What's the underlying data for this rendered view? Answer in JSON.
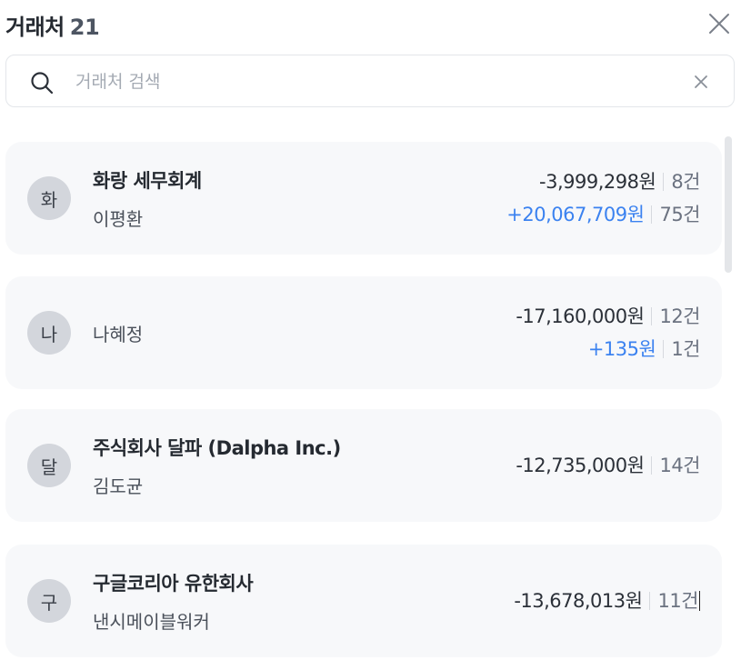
{
  "header": {
    "title": "거래처",
    "count": "21"
  },
  "search": {
    "placeholder": "거래처 검색"
  },
  "icons": {
    "close": "close-icon",
    "search": "search-icon",
    "clear": "clear-icon"
  },
  "colors": {
    "positive": "#3b82f0",
    "card_bg": "#f7f8fa",
    "avatar_bg": "#d3d6dc"
  },
  "vendors": [
    {
      "avatar": "화",
      "company": "화랑 세무회계",
      "person": "이평환",
      "rows": [
        {
          "amount": "-3,999,298원",
          "count": "8건",
          "type": "neg"
        },
        {
          "amount": "+20,067,709원",
          "count": "75건",
          "type": "pos"
        }
      ]
    },
    {
      "avatar": "나",
      "company": "",
      "person": "나혜정",
      "rows": [
        {
          "amount": "-17,160,000원",
          "count": "12건",
          "type": "neg"
        },
        {
          "amount": "+135원",
          "count": "1건",
          "type": "pos"
        }
      ]
    },
    {
      "avatar": "달",
      "company": "주식회사 달파 (Dalpha Inc.)",
      "person": "김도균",
      "rows": [
        {
          "amount": "-12,735,000원",
          "count": "14건",
          "type": "neg"
        }
      ]
    },
    {
      "avatar": "구",
      "company": "구글코리아 유한회사",
      "person": "낸시메이블워커",
      "rows": [
        {
          "amount": "-13,678,013원",
          "count": "11건",
          "type": "neg"
        }
      ]
    }
  ]
}
